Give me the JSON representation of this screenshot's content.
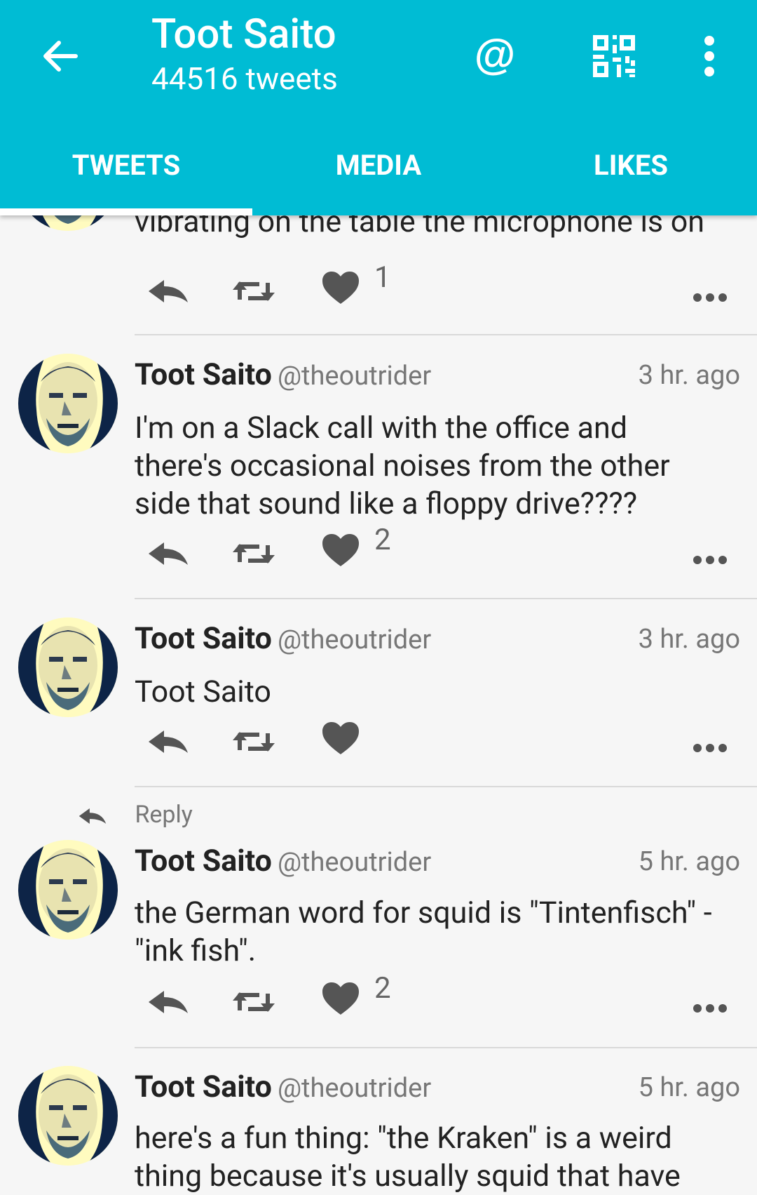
{
  "header": {
    "title": "Toot Saito",
    "subtitle": "44516 tweets",
    "accent_color": "#00bcd4",
    "icons": [
      "back-arrow-icon",
      "mention-icon",
      "qr-code-icon",
      "overflow-menu-icon"
    ]
  },
  "tabs": [
    {
      "label": "TWEETS",
      "active": true
    },
    {
      "label": "MEDIA",
      "active": false
    },
    {
      "label": "LIKES",
      "active": false
    }
  ],
  "tweets": [
    {
      "text_tail": "vibrating on the table the microphone is on",
      "likes": "1"
    },
    {
      "author": "Toot Saito",
      "handle": "@theoutrider",
      "time": "3 hr. ago",
      "lines": [
        "I'm on a Slack call with the office and",
        "there's occasional noises from the other",
        "side that sound like a floppy drive????"
      ],
      "likes": "2"
    },
    {
      "author": "Toot Saito",
      "handle": "@theoutrider",
      "time": "3 hr. ago",
      "lines": [
        "Toot Saito"
      ],
      "likes": ""
    },
    {
      "context": "Reply",
      "author": "Toot Saito",
      "handle": "@theoutrider",
      "time": "5 hr. ago",
      "lines": [
        "the German word for squid is \"Tintenfisch\" -",
        "\"ink fish\"."
      ],
      "likes": "2"
    },
    {
      "author": "Toot Saito",
      "handle": "@theoutrider",
      "time": "5 hr. ago",
      "lines": [
        "here's a fun thing: \"the Kraken\" is a weird",
        "thing because it's usually squid that have"
      ]
    }
  ]
}
